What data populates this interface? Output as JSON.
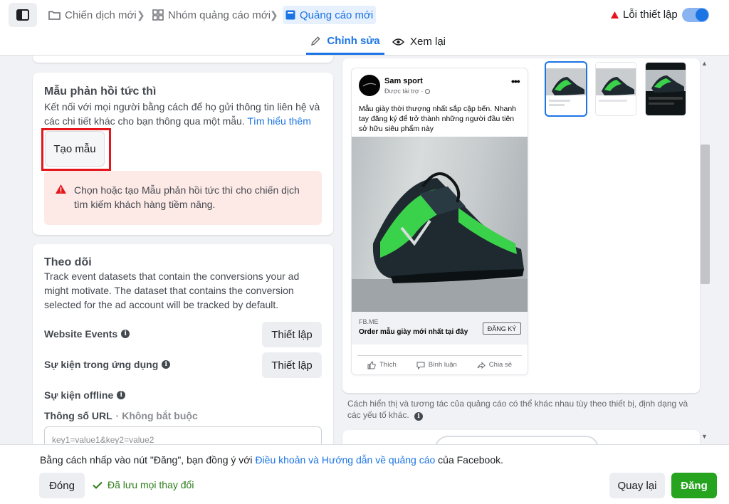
{
  "breadcrumbs": [
    {
      "label": "Chiến dịch mới",
      "icon": "folder-icon"
    },
    {
      "label": "Nhóm quảng cáo mới",
      "icon": "grid-icon"
    },
    {
      "label": "Quảng cáo mới",
      "icon": "ad-icon"
    }
  ],
  "header": {
    "error_status": "Lỗi thiết lập"
  },
  "tabs": [
    {
      "label": "Chỉnh sửa",
      "icon": "pencil-icon",
      "active": true
    },
    {
      "label": "Xem lại",
      "icon": "eye-icon",
      "active": false
    }
  ],
  "lead_form": {
    "title": "Mẫu phản hồi tức thì",
    "description": "Kết nối với mọi người bằng cách để họ gửi thông tin liên hệ và các chi tiết khác cho bạn thông qua một mẫu.",
    "learn_more": "Tìm hiểu thêm",
    "create_button": "Tạo mẫu",
    "warning": "Chọn hoặc tạo Mẫu phản hồi tức thì cho chiến dịch tìm kiếm khách hàng tiềm năng."
  },
  "tracking": {
    "title": "Theo dõi",
    "description": "Track event datasets that contain the conversions your ad might motivate. The dataset that contains the conversion selected for the ad account will be tracked by default.",
    "website_events": "Website Events",
    "app_events": "Sự kiện trong ứng dụng",
    "offline_events": "Sự kiện offline",
    "setup_button": "Thiết lập",
    "url_params_label": "Thông số URL",
    "url_params_optional": "· Không bắt buộc",
    "url_params_placeholder": "key1=value1&key2=value2"
  },
  "preview": {
    "page_name": "Sam sport",
    "sponsored": "Được tài trợ ·",
    "body": "Mẫu giày thời thượng nhất sắp cập bến. Nhanh tay đăng ký để trở thành những người đầu tiên sở hữu siêu phẩm này",
    "link_domain": "FB.ME",
    "link_title": "Order mẫu giày mới nhất tại đây",
    "cta": "ĐĂNG KÝ",
    "actions": {
      "like": "Thích",
      "comment": "Bình luận",
      "share": "Chia sẻ"
    },
    "note": "Cách hiển thị và tương tác của quảng cáo có thể khác nhau tùy theo thiết bị, định dạng và các yếu tố khác."
  },
  "footer": {
    "consent_prefix": "Bằng cách nhấp vào nút \"Đăng\", bạn đồng ý với",
    "consent_link": "Điều khoản và Hướng dẫn về quảng cáo",
    "consent_suffix": "của Facebook.",
    "close": "Đóng",
    "saved": "Đã lưu mọi thay đổi",
    "back": "Quay lại",
    "publish": "Đăng"
  },
  "colors": {
    "accent": "#1b74e4",
    "error": "#e4161b",
    "success": "#26a31f",
    "warning_bg": "#fde9e6"
  }
}
